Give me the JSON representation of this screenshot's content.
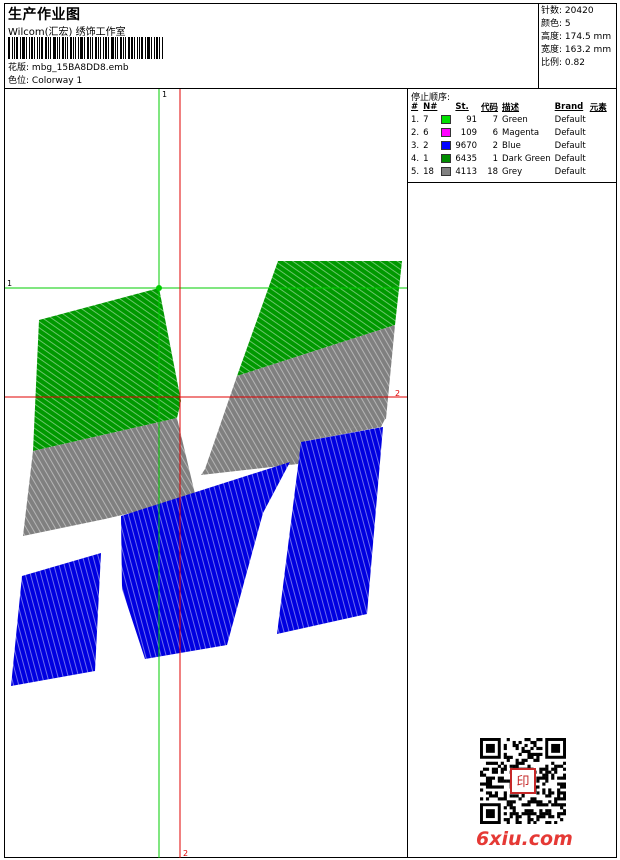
{
  "header": {
    "title": "生产作业图",
    "company": "Wilcom(汇宏) 绣饰工作室",
    "design_label": "花版:",
    "design_file": "mbg_15BA8DD8.emb",
    "colorway_label": "色位:",
    "colorway": "Colorway 1"
  },
  "stats": [
    {
      "label": "针数:",
      "value": "20420"
    },
    {
      "label": "颜色:",
      "value": "5"
    },
    {
      "label": "高度:",
      "value": "174.5 mm"
    },
    {
      "label": "宽度:",
      "value": "163.2 mm"
    },
    {
      "label": "比例:",
      "value": "0.82"
    }
  ],
  "stop_sequence": {
    "title": "停止顺序:",
    "headers": [
      "#",
      "N#",
      "St.",
      "代码",
      "描述",
      "Brand",
      "元素"
    ],
    "rows": [
      {
        "idx": "1.",
        "n": "7",
        "swatch": "#00e000",
        "st": "91",
        "code": "7",
        "desc": "Green",
        "brand": "Default"
      },
      {
        "idx": "2.",
        "n": "6",
        "swatch": "#ff00ff",
        "st": "109",
        "code": "6",
        "desc": "Magenta",
        "brand": "Default"
      },
      {
        "idx": "3.",
        "n": "2",
        "swatch": "#0000ff",
        "st": "9670",
        "code": "2",
        "desc": "Blue",
        "brand": "Default"
      },
      {
        "idx": "4.",
        "n": "1",
        "swatch": "#008c00",
        "st": "6435",
        "code": "1",
        "desc": "Dark Green",
        "brand": "Default"
      },
      {
        "idx": "5.",
        "n": "18",
        "swatch": "#808080",
        "st": "4113",
        "code": "18",
        "desc": "Grey",
        "brand": "Default"
      }
    ]
  },
  "crosshair_labels": {
    "green_v": "1",
    "green_h": "1",
    "red_h": "2",
    "red_v": "2"
  },
  "design_colors": {
    "green": "#009900",
    "grey": "#808080",
    "blue": "#0000e0",
    "crosshair_green": "#00cc00",
    "crosshair_red": "#e00000"
  },
  "watermark": {
    "text": "6xiu.com",
    "qr_stamp": "印"
  }
}
